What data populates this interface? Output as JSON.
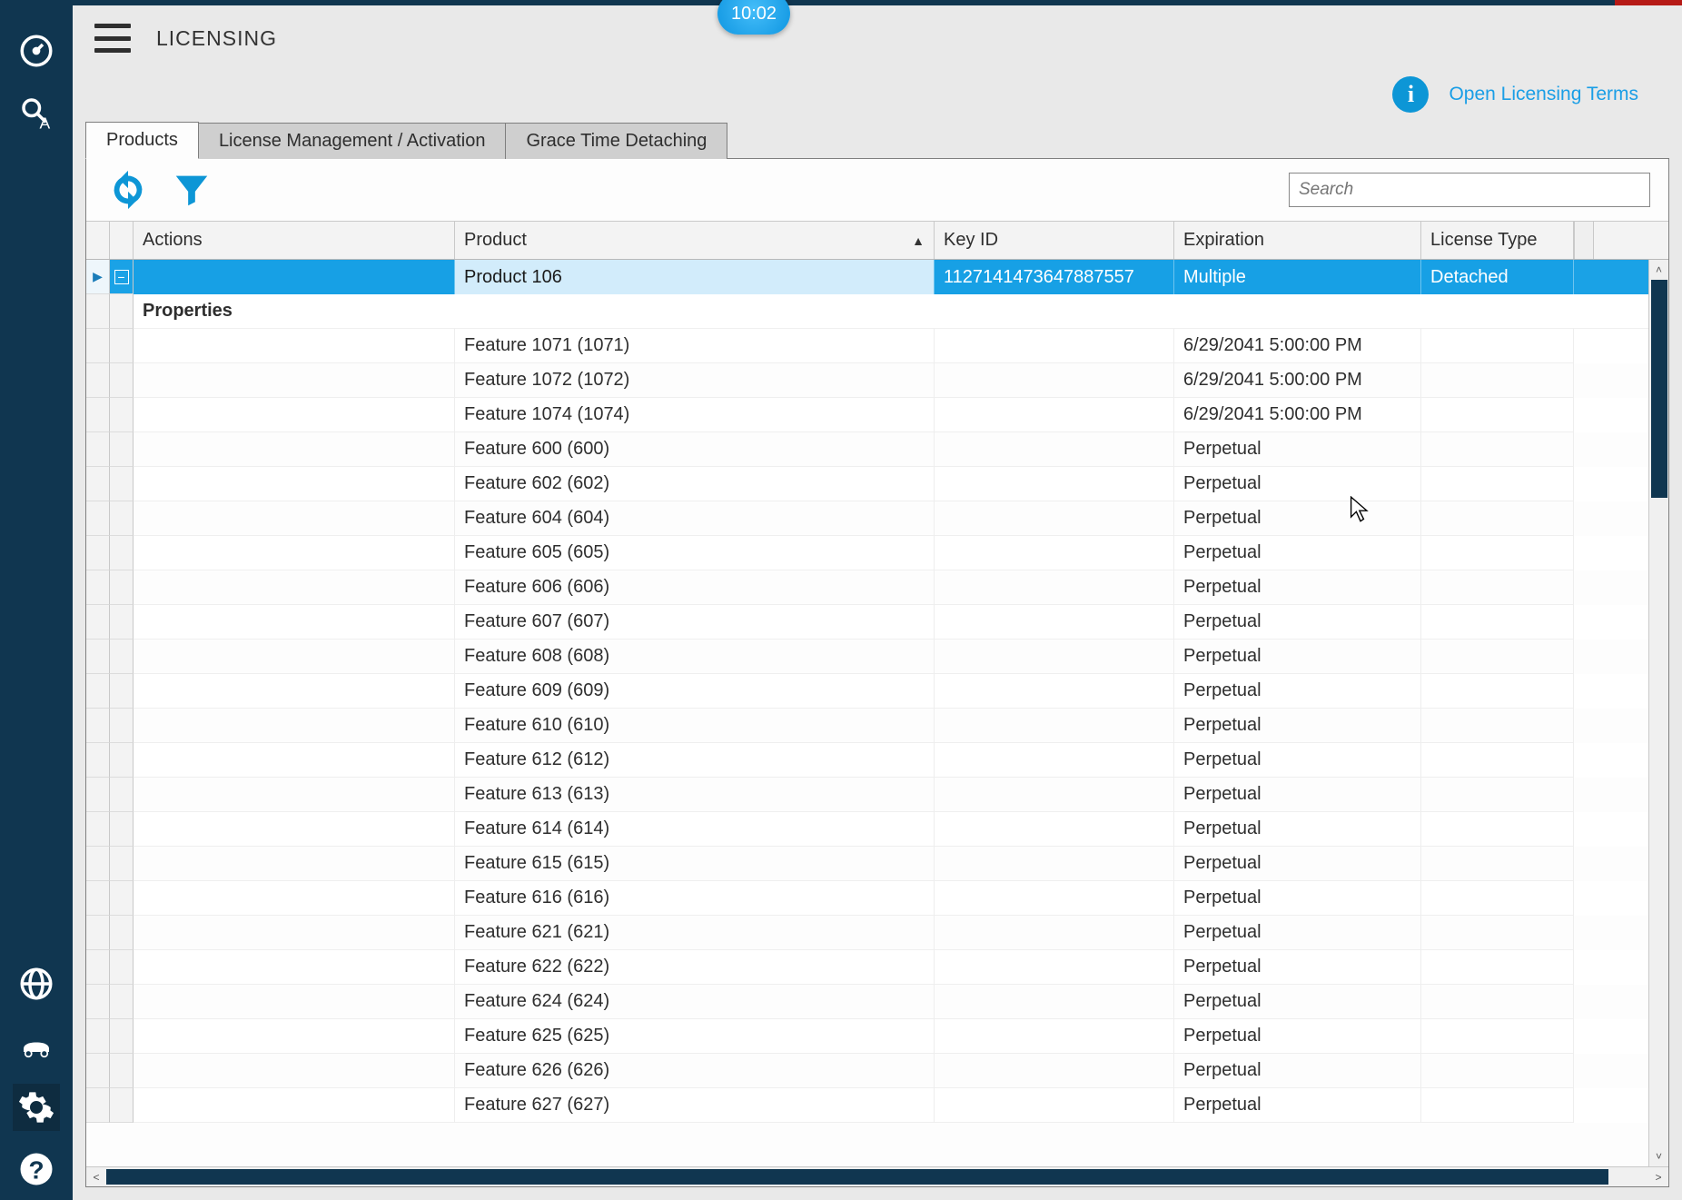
{
  "clock": "10:02",
  "header": {
    "title": "LICENSING"
  },
  "info": {
    "link_label": "Open Licensing Terms"
  },
  "tabs": [
    {
      "label": "Products",
      "active": true
    },
    {
      "label": "License Management / Activation",
      "active": false
    },
    {
      "label": "Grace Time Detaching",
      "active": false
    }
  ],
  "toolbar": {
    "search_placeholder": "Search"
  },
  "grid": {
    "columns": {
      "actions": "Actions",
      "product": "Product",
      "key_id": "Key ID",
      "expiration": "Expiration",
      "license_type": "License Type"
    },
    "selected_row": {
      "product": "Product 106",
      "key_id": "1127141473647887557",
      "expiration": "Multiple",
      "license_type": "Detached"
    },
    "properties_label": "Properties",
    "features": [
      {
        "product": "Feature 1071 (1071)",
        "expiration": "6/29/2041 5:00:00 PM"
      },
      {
        "product": "Feature 1072 (1072)",
        "expiration": "6/29/2041 5:00:00 PM"
      },
      {
        "product": "Feature 1074 (1074)",
        "expiration": "6/29/2041 5:00:00 PM"
      },
      {
        "product": "Feature 600 (600)",
        "expiration": "Perpetual"
      },
      {
        "product": "Feature 602 (602)",
        "expiration": "Perpetual"
      },
      {
        "product": "Feature 604 (604)",
        "expiration": "Perpetual"
      },
      {
        "product": "Feature 605 (605)",
        "expiration": "Perpetual"
      },
      {
        "product": "Feature 606 (606)",
        "expiration": "Perpetual"
      },
      {
        "product": "Feature 607 (607)",
        "expiration": "Perpetual"
      },
      {
        "product": "Feature 608 (608)",
        "expiration": "Perpetual"
      },
      {
        "product": "Feature 609 (609)",
        "expiration": "Perpetual"
      },
      {
        "product": "Feature 610 (610)",
        "expiration": "Perpetual"
      },
      {
        "product": "Feature 612 (612)",
        "expiration": "Perpetual"
      },
      {
        "product": "Feature 613 (613)",
        "expiration": "Perpetual"
      },
      {
        "product": "Feature 614 (614)",
        "expiration": "Perpetual"
      },
      {
        "product": "Feature 615 (615)",
        "expiration": "Perpetual"
      },
      {
        "product": "Feature 616 (616)",
        "expiration": "Perpetual"
      },
      {
        "product": "Feature 621 (621)",
        "expiration": "Perpetual"
      },
      {
        "product": "Feature 622 (622)",
        "expiration": "Perpetual"
      },
      {
        "product": "Feature 624 (624)",
        "expiration": "Perpetual"
      },
      {
        "product": "Feature 625 (625)",
        "expiration": "Perpetual"
      },
      {
        "product": "Feature 626 (626)",
        "expiration": "Perpetual"
      },
      {
        "product": "Feature 627 (627)",
        "expiration": "Perpetual"
      }
    ]
  }
}
